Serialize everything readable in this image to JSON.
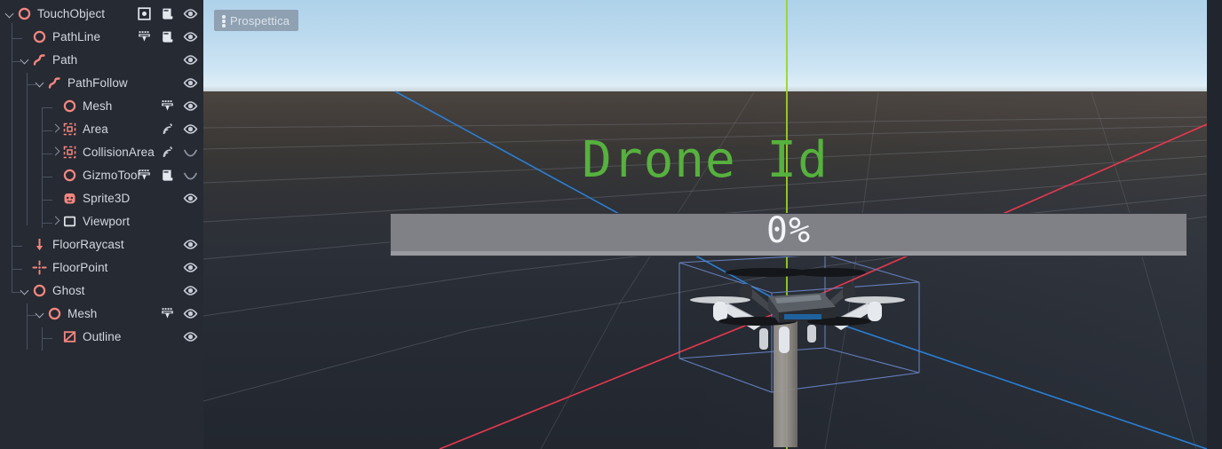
{
  "scene_tree": {
    "panel_bg": "#252a33",
    "nodes": [
      {
        "label": "TouchObject",
        "depth": 0,
        "twisty": "down",
        "icon": "node3d-circle-icon",
        "tools": [
          "unique-node-icon",
          "script-icon",
          "visibility-on-icon"
        ]
      },
      {
        "label": "PathLine",
        "depth": 1,
        "twisty": "none",
        "icon": "node3d-circle-icon",
        "tools": [
          "animation-icon",
          "script-icon",
          "visibility-on-icon"
        ]
      },
      {
        "label": "Path",
        "depth": 1,
        "twisty": "down",
        "icon": "path3d-curve-icon",
        "tools": [
          "visibility-on-icon"
        ]
      },
      {
        "label": "PathFollow",
        "depth": 2,
        "twisty": "down",
        "icon": "path3d-curve-icon",
        "tools": [
          "visibility-on-icon"
        ]
      },
      {
        "label": "Mesh",
        "depth": 3,
        "twisty": "none",
        "icon": "node3d-circle-icon",
        "tools": [
          "animation-icon",
          "visibility-on-icon"
        ]
      },
      {
        "label": "Area",
        "depth": 3,
        "twisty": "right",
        "icon": "area3d-icon",
        "tools": [
          "signal-icon",
          "visibility-on-icon"
        ]
      },
      {
        "label": "CollisionArea",
        "depth": 3,
        "twisty": "right",
        "icon": "area3d-icon",
        "tools": [
          "signal-icon",
          "visibility-off-icon"
        ]
      },
      {
        "label": "GizmoTool",
        "depth": 3,
        "twisty": "none",
        "icon": "node3d-circle-icon",
        "tools": [
          "animation-icon",
          "script-icon",
          "visibility-off-icon"
        ]
      },
      {
        "label": "Sprite3D",
        "depth": 3,
        "twisty": "none",
        "icon": "sprite3d-face-icon",
        "tools": [
          "visibility-on-icon"
        ]
      },
      {
        "label": "Viewport",
        "depth": 3,
        "twisty": "right",
        "icon": "viewport-square-icon",
        "tools": []
      },
      {
        "label": "FloorRaycast",
        "depth": 1,
        "twisty": "none",
        "icon": "raycast-arrow-icon",
        "tools": [
          "visibility-on-icon"
        ]
      },
      {
        "label": "FloorPoint",
        "depth": 1,
        "twisty": "none",
        "icon": "marker3d-cross-icon",
        "tools": [
          "visibility-on-icon"
        ]
      },
      {
        "label": "Ghost",
        "depth": 1,
        "twisty": "down",
        "icon": "node3d-circle-icon",
        "tools": [
          "visibility-on-icon"
        ]
      },
      {
        "label": "Mesh",
        "depth": 2,
        "twisty": "down",
        "icon": "node3d-circle-icon",
        "tools": [
          "animation-icon",
          "visibility-on-icon"
        ]
      },
      {
        "label": "Outline",
        "depth": 3,
        "twisty": "none",
        "icon": "meshinstance-outline-icon",
        "tools": [
          "visibility-on-icon"
        ]
      }
    ]
  },
  "viewport": {
    "menu_label": "Prospettica",
    "menu_icon": "vertical-dots-icon",
    "drone_label": "Drone Id",
    "drone_label_color": "#56b13e",
    "progress": {
      "text": "0%",
      "percent": 0,
      "track_color": "#808087",
      "text_color": "#f2f4f7"
    },
    "sky_color_top": "#aed2ea",
    "sky_color_bottom": "#dfeef7",
    "ground_color": "#2a2f38",
    "gizmo_axis_x_color": "#e8384f",
    "gizmo_axis_y_color": "#9ad523",
    "gizmo_axis_z_color": "#2b7fd4",
    "selection_box_color": "#6b86c9"
  }
}
